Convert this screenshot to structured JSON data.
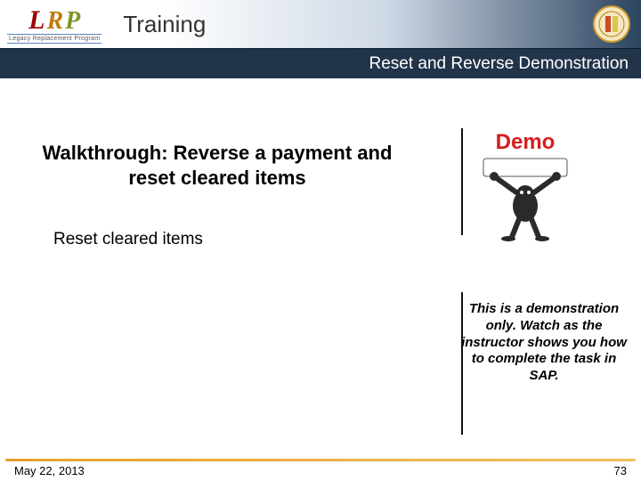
{
  "header": {
    "logo_letters": {
      "L": "L",
      "R": "R",
      "P": "P"
    },
    "logo_tagline": "Legacy Replacement Program",
    "section_title": "Training"
  },
  "subheader": {
    "title": "Reset and Reverse Demonstration"
  },
  "content": {
    "walkthrough": "Walkthrough: Reverse a payment and reset cleared items",
    "subhead": "Reset cleared items",
    "demo_label": "Demo",
    "demo_note": "This is a demonstration only. Watch as the instructor shows you how to complete the task in SAP."
  },
  "footer": {
    "date": "May 22, 2013",
    "page": "73"
  },
  "icons": {
    "seal": "seal-icon",
    "demo_figure": "demo-figure-icon"
  }
}
